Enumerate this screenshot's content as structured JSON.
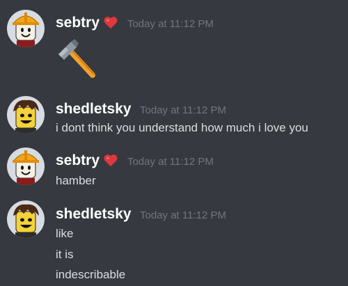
{
  "colors": {
    "background": "#36393f",
    "username": "#ffffff",
    "timestamp": "#72767d",
    "text": "#dcddde",
    "heart": "#e0383f"
  },
  "messages": [
    {
      "author": "sebtry",
      "timestamp": "Today at 11:12 PM",
      "badge": "heart-icon",
      "content": [
        "hammer-emoji"
      ]
    },
    {
      "author": "shedletsky",
      "timestamp": "Today at 11:12 PM",
      "content": [
        "i dont think you understand how much i love you"
      ]
    },
    {
      "author": "sebtry",
      "timestamp": "Today at 11:12 PM",
      "badge": "heart-icon",
      "content": [
        "hamber"
      ]
    },
    {
      "author": "shedletsky",
      "timestamp": "Today at 11:12 PM",
      "content": [
        "like",
        "it is",
        "indescribable"
      ]
    }
  ]
}
